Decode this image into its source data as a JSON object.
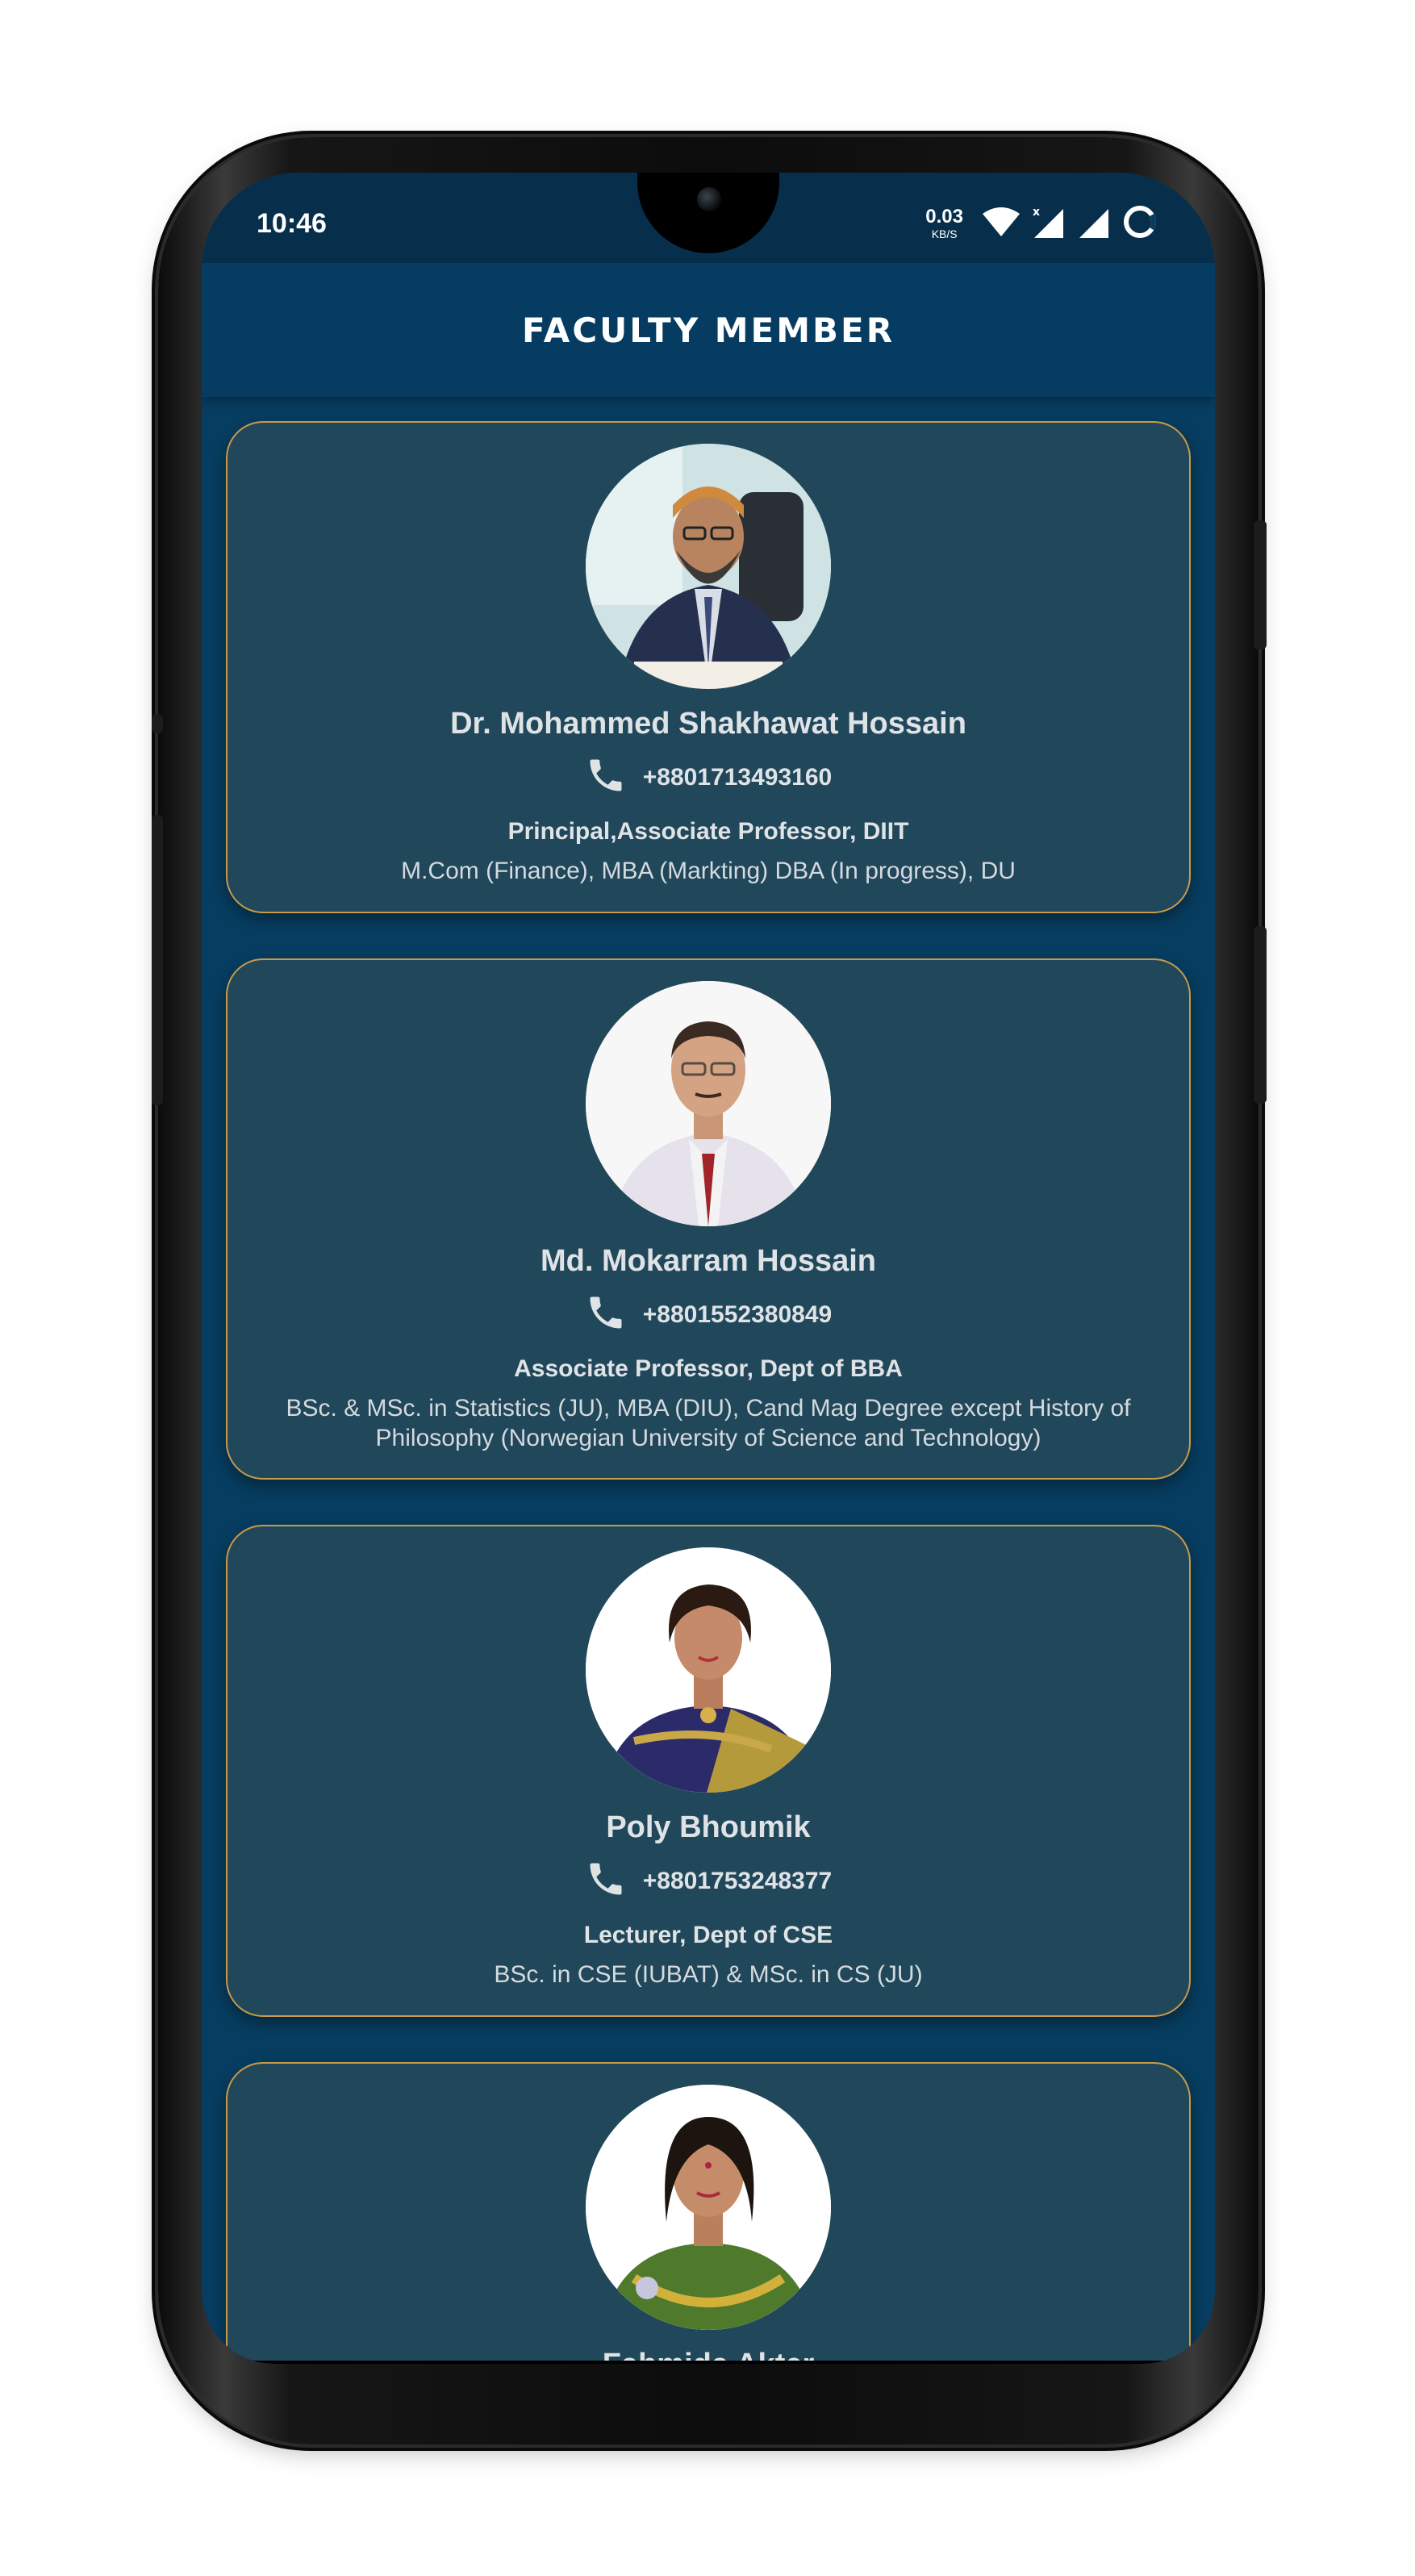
{
  "status_bar": {
    "time": "10:46",
    "net_speed": "0.03",
    "net_unit": "KB/S",
    "icons": [
      "wifi-icon",
      "signal-x-icon",
      "signal-icon",
      "loading-ring-icon"
    ]
  },
  "app_bar": {
    "title": "FACULTY MEMBER"
  },
  "faculty": [
    {
      "name": "Dr. Mohammed Shakhawat Hossain",
      "phone": "+8801713493160",
      "role": "Principal,Associate Professor, DIIT",
      "education": "M.Com (Finance), MBA (Markting) DBA (In progress), DU"
    },
    {
      "name": "Md. Mokarram Hossain",
      "phone": "+8801552380849",
      "role": "Associate Professor, Dept of BBA",
      "education": "BSc. & MSc. in Statistics (JU), MBA (DIU), Cand Mag Degree except History of Philosophy (Norwegian University of Science and Technology)"
    },
    {
      "name": "Poly Bhoumik",
      "phone": "+8801753248377",
      "role": "Lecturer, Dept of CSE",
      "education": "BSc. in CSE (IUBAT) & MSc. in CS (JU)"
    },
    {
      "name": "Fahmida Akter"
    }
  ],
  "colors": {
    "screen_bg": "#073d60",
    "card_bg": "#21475b",
    "card_border": "#c89b4a",
    "text": "#dfe3e6"
  }
}
